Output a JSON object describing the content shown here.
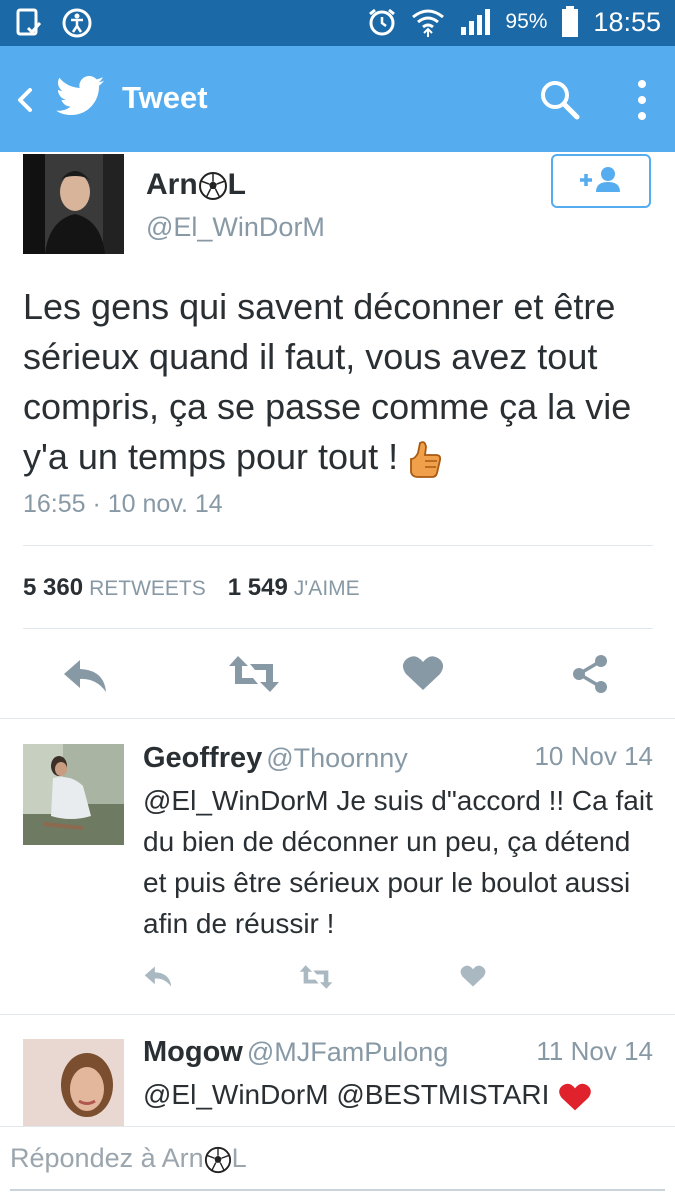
{
  "status_bar": {
    "battery": "95%",
    "time": "18:55"
  },
  "app_bar": {
    "title": "Tweet"
  },
  "tweet": {
    "author_name_part1": "Arn",
    "author_name_part2": "L",
    "author_handle": "@El_WinDorM",
    "text": "Les gens qui savent déconner et être sérieux quand il faut, vous avez tout compris, ça se passe comme ça la vie y'a un temps pour tout !",
    "timestamp": "16:55 · 10 nov. 14",
    "retweets_count": "5 360",
    "retweets_label": "RETWEETS",
    "likes_count": "1 549",
    "likes_label": "J'AIME"
  },
  "replies": [
    {
      "name": "Geoffrey",
      "handle": "@Thoornny",
      "date": "10 Nov 14",
      "text": "@El_WinDorM Je suis d\"accord !! Ca fait du bien de déconner un peu, ça détend et puis être sérieux pour le boulot aussi afin de réussir !"
    },
    {
      "name": "Mogow",
      "handle": "@MJFamPulong",
      "date": "11 Nov 14",
      "text": "@El_WinDorM @BESTMISTARI"
    }
  ],
  "reply_input": {
    "placeholder_part1": "Répondez à Arn",
    "placeholder_part2": "L"
  },
  "colors": {
    "status_bar": "#1b69a6",
    "app_bar": "#55acee",
    "action_icon": "#8899a6"
  }
}
